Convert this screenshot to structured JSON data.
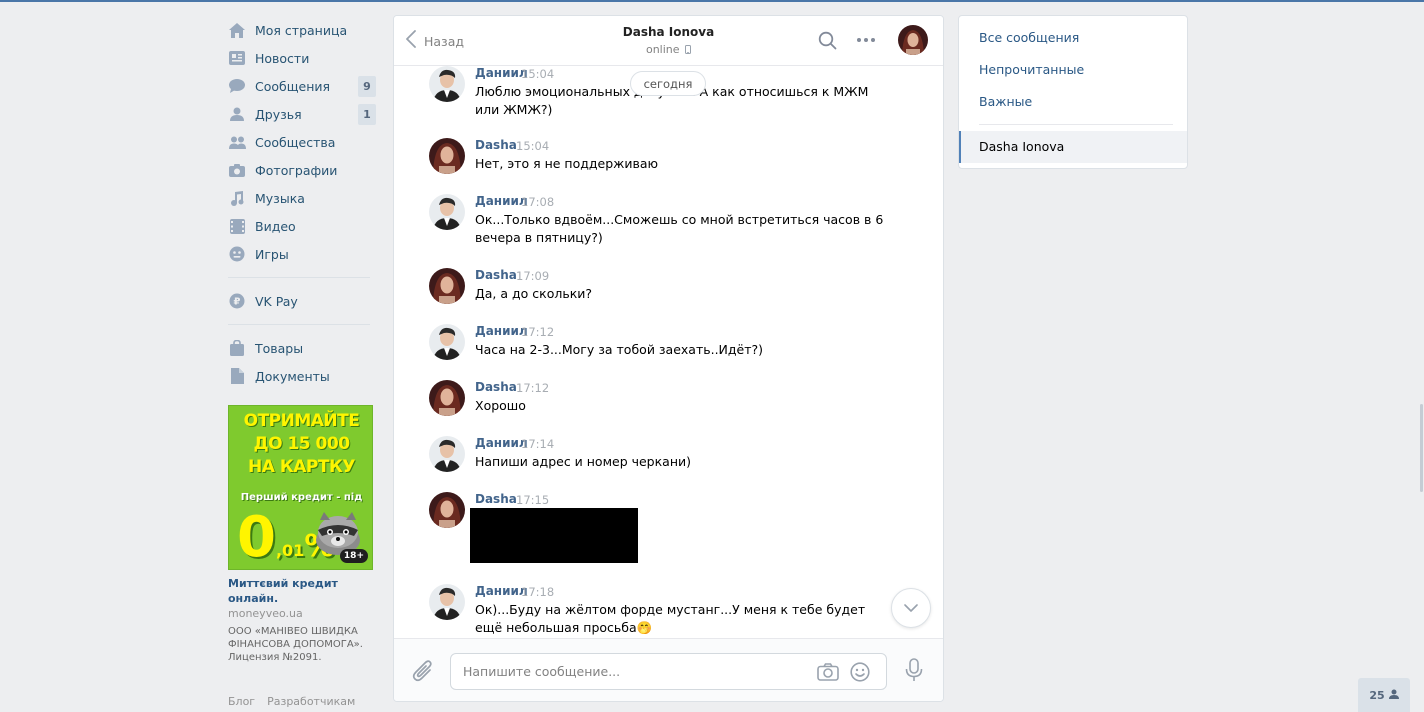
{
  "nav": {
    "items": [
      {
        "label": "Моя страница",
        "icon": "home-icon"
      },
      {
        "label": "Новости",
        "icon": "news-icon"
      },
      {
        "label": "Сообщения",
        "icon": "messages-icon",
        "badge": "9"
      },
      {
        "label": "Друзья",
        "icon": "friends-icon",
        "badge": "1"
      },
      {
        "label": "Сообщества",
        "icon": "groups-icon"
      },
      {
        "label": "Фотографии",
        "icon": "camera-icon"
      },
      {
        "label": "Музыка",
        "icon": "music-icon"
      },
      {
        "label": "Видео",
        "icon": "video-icon"
      },
      {
        "label": "Игры",
        "icon": "games-icon"
      }
    ],
    "vkpay": {
      "label": "VK Pay",
      "icon": "ruble-icon"
    },
    "extra": [
      {
        "label": "Товары",
        "icon": "bag-icon"
      },
      {
        "label": "Документы",
        "icon": "document-icon"
      }
    ]
  },
  "ad": {
    "banner_line1": "ОТРИМАЙТЕ",
    "banner_line2": "ДО 15 000",
    "banner_line3": "НА КАРТКУ",
    "banner_sub": "Перший кредит - під",
    "banner_percent_main": "0",
    "banner_percent_small": ",01",
    "banner_percent_sign": "%",
    "banner_age": "18+",
    "name": "Миттєвий кредит онлайн.",
    "domain": "moneyveo.ua",
    "legal": "ООО «МАНІВЕО ШВИДКА ФІНАНСОВА ДОПОМОГА». Лицензия №2091."
  },
  "footer": {
    "blog": "Блог",
    "developers": "Разработчикам"
  },
  "chat": {
    "back_label": "Назад",
    "peer_name": "Dasha Ionova",
    "peer_status": "online",
    "date_pill": "сегодня",
    "input_placeholder": "Напишите сообщение...",
    "messages": [
      {
        "author": "Даниил",
        "time": "15:04",
        "text": "Люблю эмоциональных девушек. А как относишься к МЖМ или ЖМЖ?)"
      },
      {
        "author": "Dasha",
        "time": "15:04",
        "text": "Нет, это я не поддерживаю"
      },
      {
        "author": "Даниил",
        "time": "17:08",
        "text": "Ок...Только вдвоём...Сможешь со мной встретиться часов в 6 вечера в пятницу?)"
      },
      {
        "author": "Dasha",
        "time": "17:09",
        "text": "Да, а до скольки?"
      },
      {
        "author": "Даниил",
        "time": "17:12",
        "text": "Часа на 2-3...Могу за тобой заехать..Идёт?)"
      },
      {
        "author": "Dasha",
        "time": "17:12",
        "text": "Хорошо"
      },
      {
        "author": "Даниил",
        "time": "17:14",
        "text": "Напиши адрес и номер черкани)"
      },
      {
        "author": "Dasha",
        "time": "17:15",
        "text": ""
      },
      {
        "author": "Даниил",
        "time": "17:18",
        "text": "Ок)...Буду на жёлтом форде мустанг...У меня к тебе будет ещё небольшая просьба🤭"
      }
    ]
  },
  "right": {
    "all": "Все сообщения",
    "unread": "Непрочитанные",
    "important": "Важные",
    "active_chat": "Dasha Ionova"
  },
  "corner": {
    "count": "25"
  },
  "colors": {
    "accent": "#4a76a8",
    "link": "#2a5885",
    "author": "#42648b",
    "ad_bg": "#7fca2e",
    "ad_text": "#fff500"
  }
}
